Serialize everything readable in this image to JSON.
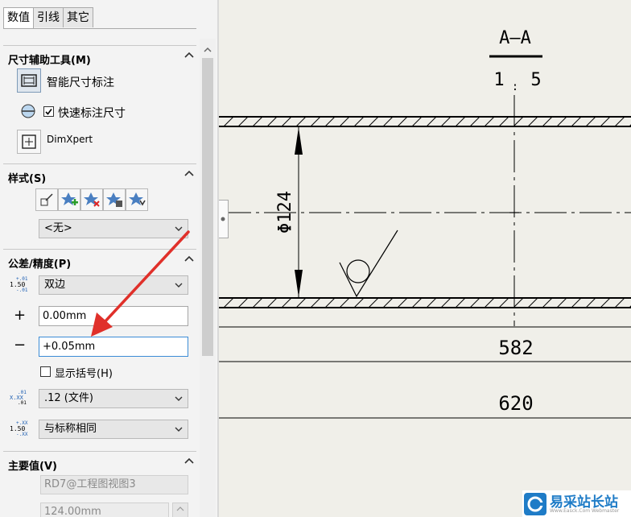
{
  "tabs": [
    {
      "label": "数值",
      "active": true
    },
    {
      "label": "引线",
      "active": false
    },
    {
      "label": "其它",
      "active": false
    }
  ],
  "sections": {
    "dim_tools": {
      "title": "尺寸辅助工具(M)",
      "smart_dimension": "智能尺寸标注",
      "quick_dimension": "快速标注尺寸",
      "quick_dimension_checked": true,
      "dimxpert": "DimXpert"
    },
    "style": {
      "title": "样式(S)",
      "selected": "<无>"
    },
    "tolerance": {
      "title": "公差/精度(P)",
      "type_icon_text": {
        "top": "+.01",
        "mid": "1.50",
        "bot": "-.01"
      },
      "type": "双边",
      "upper_sign": "+",
      "upper_value": "0.00mm",
      "lower_sign": "−",
      "lower_value": "+0.05mm",
      "show_parens": "显示括号(H)",
      "show_parens_checked": false,
      "precision_icon_text": {
        "top": ".01",
        "mid": "X.XX",
        "bot": ".01"
      },
      "precision": ".12 (文件)",
      "tol_precision_icon_text": {
        "top": "+.XX",
        "mid": "1.50",
        "bot": "-.XX"
      },
      "tol_precision": "与标称相同"
    },
    "primary_value": {
      "title": "主要值(V)",
      "reference": "RD7@工程图视图3",
      "value": "124.00mm"
    }
  },
  "drawing": {
    "section_title": "A—A",
    "scale_left": "1",
    "scale_sep": ":",
    "scale_right": "5",
    "dim_diameter": "Φ124",
    "dim_582": "582",
    "dim_620": "620"
  },
  "watermark": {
    "brand": "易采站长站",
    "sub": "Www.Easck.Com Webmaster"
  },
  "colors": {
    "panel_bg": "#f3f3f3",
    "drawing_bg": "#f0efe9",
    "arrow_red": "#e0302a",
    "focus_blue": "#3c8cd6",
    "watermark_blue": "#1f7cc7"
  }
}
